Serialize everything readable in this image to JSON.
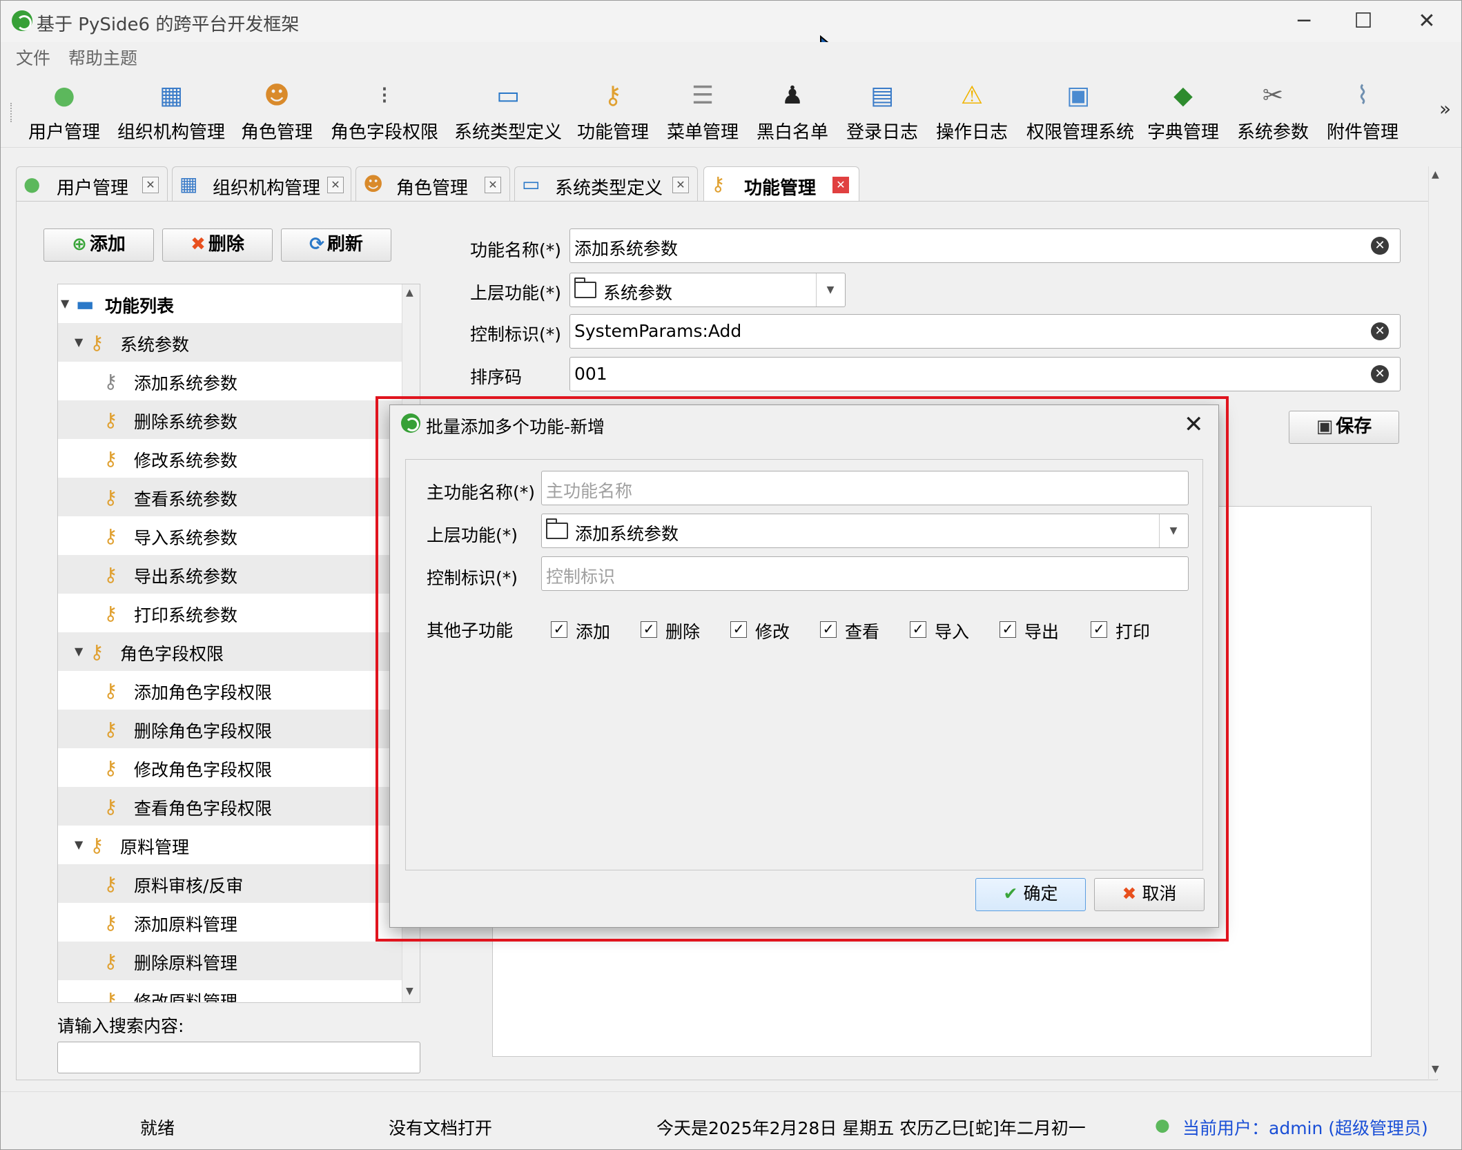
{
  "window": {
    "title": "基于 PySide6 的跨平台开发框架",
    "minimize": "─",
    "maximize": "☐",
    "close": "✕"
  },
  "menu": [
    "文件",
    "帮助主题"
  ],
  "toolbar": [
    {
      "label": "用户管理",
      "icon": "user-icon"
    },
    {
      "label": "组织机构管理",
      "icon": "org-chart-icon"
    },
    {
      "label": "角色管理",
      "icon": "users-group-icon"
    },
    {
      "label": "角色字段权限",
      "icon": "traffic-light-icon"
    },
    {
      "label": "系统类型定义",
      "icon": "monitor-icon"
    },
    {
      "label": "功能管理",
      "icon": "keys-icon"
    },
    {
      "label": "菜单管理",
      "icon": "menu-doc-icon"
    },
    {
      "label": "黑白名单",
      "icon": "person-black-icon"
    },
    {
      "label": "登录日志",
      "icon": "log-window-icon"
    },
    {
      "label": "操作日志",
      "icon": "warning-icon"
    },
    {
      "label": "权限管理系统",
      "icon": "computers-icon"
    },
    {
      "label": "字典管理",
      "icon": "book-icon"
    },
    {
      "label": "系统参数",
      "icon": "tools-icon"
    },
    {
      "label": "附件管理",
      "icon": "paperclip-icon"
    }
  ],
  "toolbar_more": "»",
  "tabs": [
    {
      "label": "用户管理",
      "icon": "user-icon"
    },
    {
      "label": "组织机构管理",
      "icon": "org-chart-icon"
    },
    {
      "label": "角色管理",
      "icon": "users-group-icon"
    },
    {
      "label": "系统类型定义",
      "icon": "monitor-icon"
    },
    {
      "label": "功能管理",
      "icon": "keys-icon",
      "active": true
    }
  ],
  "actions": {
    "add": "添加",
    "delete": "删除",
    "refresh": "刷新",
    "save": "保存"
  },
  "tree": {
    "root": "功能列表",
    "rows": [
      {
        "level": 1,
        "label": "系统参数",
        "expanded": true
      },
      {
        "level": 2,
        "label": "添加系统参数",
        "selected": true
      },
      {
        "level": 2,
        "label": "删除系统参数"
      },
      {
        "level": 2,
        "label": "修改系统参数"
      },
      {
        "level": 2,
        "label": "查看系统参数"
      },
      {
        "level": 2,
        "label": "导入系统参数"
      },
      {
        "level": 2,
        "label": "导出系统参数"
      },
      {
        "level": 2,
        "label": "打印系统参数"
      },
      {
        "level": 1,
        "label": "角色字段权限",
        "expanded": true
      },
      {
        "level": 2,
        "label": "添加角色字段权限"
      },
      {
        "level": 2,
        "label": "删除角色字段权限"
      },
      {
        "level": 2,
        "label": "修改角色字段权限"
      },
      {
        "level": 2,
        "label": "查看角色字段权限"
      },
      {
        "level": 1,
        "label": "原料管理",
        "expanded": true
      },
      {
        "level": 2,
        "label": "原料审核/反审"
      },
      {
        "level": 2,
        "label": "添加原料管理"
      },
      {
        "level": 2,
        "label": "删除原料管理"
      },
      {
        "level": 2,
        "label": "修改原料管理"
      }
    ]
  },
  "search": {
    "label": "请输入搜索内容:",
    "value": ""
  },
  "form": {
    "name_label": "功能名称(*)",
    "name_value": "添加系统参数",
    "parent_label": "上层功能(*)",
    "parent_value": "系统参数",
    "control_label": "控制标识(*)",
    "control_value": "SystemParams:Add",
    "order_label": "排序码",
    "order_value": "001"
  },
  "dialog": {
    "title": "批量添加多个功能-新增",
    "main_name_label": "主功能名称(*)",
    "main_name_placeholder": "主功能名称",
    "parent_label": "上层功能(*)",
    "parent_value": "添加系统参数",
    "control_label": "控制标识(*)",
    "control_placeholder": "控制标识",
    "sub_label": "其他子功能",
    "subs": [
      {
        "label": "添加",
        "checked": true
      },
      {
        "label": "删除",
        "checked": true
      },
      {
        "label": "修改",
        "checked": true
      },
      {
        "label": "查看",
        "checked": true
      },
      {
        "label": "导入",
        "checked": true
      },
      {
        "label": "导出",
        "checked": true
      },
      {
        "label": "打印",
        "checked": true
      }
    ],
    "ok": "确定",
    "cancel": "取消"
  },
  "status": {
    "ready": "就绪",
    "doc": "没有文档打开",
    "date": "今天是2025年2月28日 星期五 农历乙巳[蛇]年二月初一",
    "user": "当前用户：admin (超级管理员)"
  },
  "colors": {
    "highlight": "#e0141e",
    "link": "#1a4fd6",
    "app_green": "#37a037"
  }
}
